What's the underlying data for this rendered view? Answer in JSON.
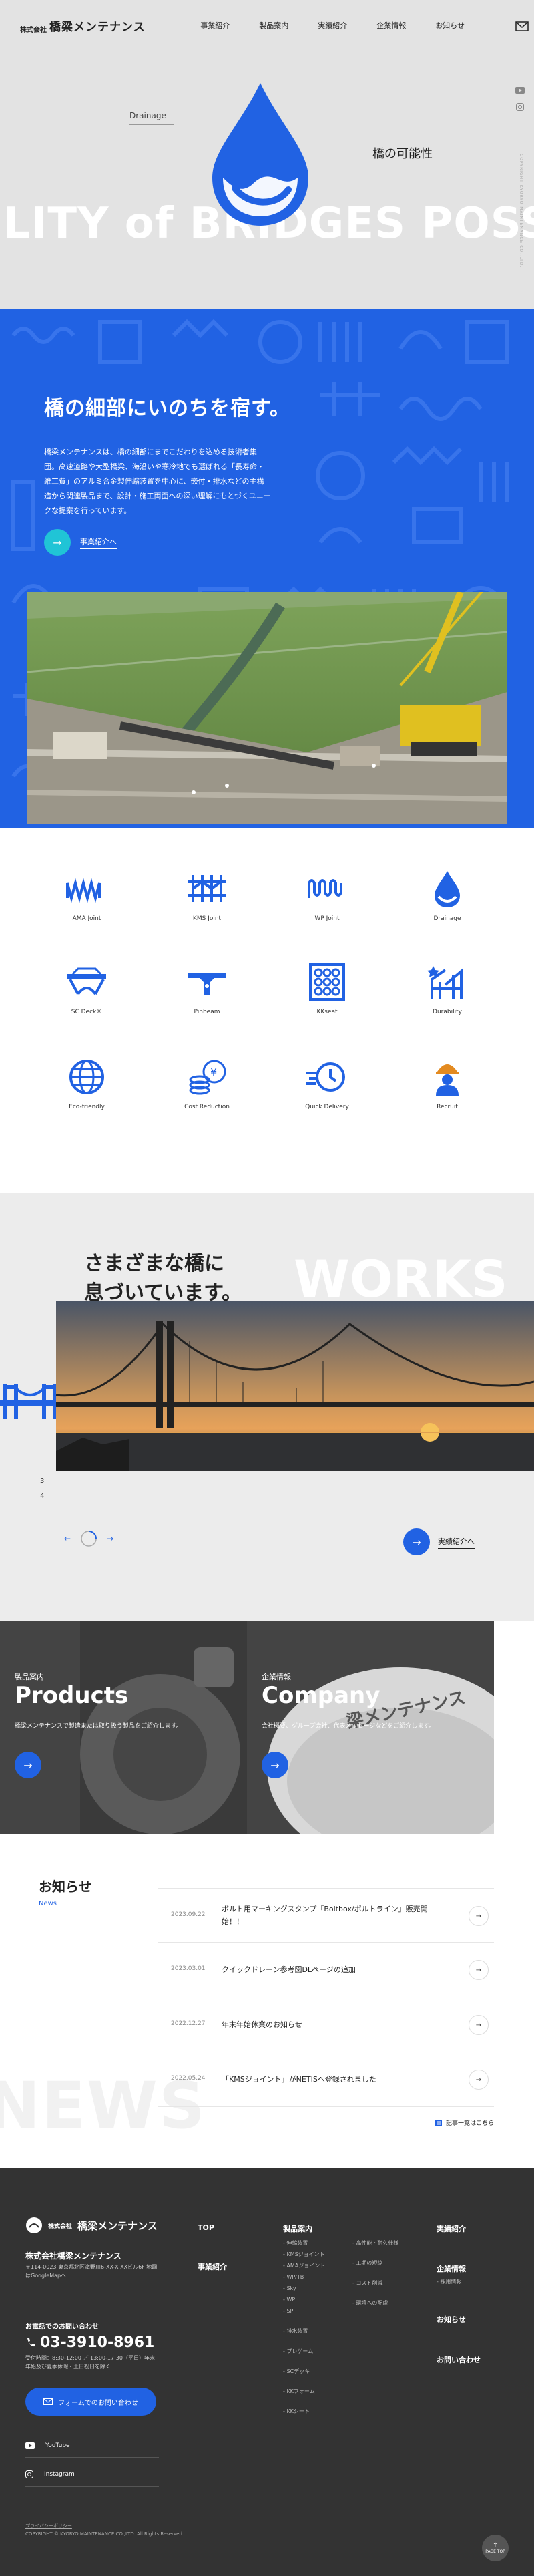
{
  "header": {
    "logo_small": "株式会社",
    "logo_large": "橋梁メンテナンス",
    "nav": [
      "事業紹介",
      "製品案内",
      "実績紹介",
      "企業情報",
      "お知らせ"
    ],
    "mail_icon": "mail-icon"
  },
  "hero": {
    "big_text": "ILITY of BRIDGES    POSSIBILITY",
    "drainage_label": "Drainage",
    "headline": "橋の可能性",
    "vertical_copy": "COPYRIGHT KYORYO MAINTENANCE CO.,LTD."
  },
  "intro": {
    "title": "橋の細部にいのちを宿す。",
    "description": "橋梁メンテナンスは、橋の細部にまでこだわりを込める技術者集団。高速道路や大型橋梁、海沿いや寒冷地でも選ばれる「長寿命・維工費」のアルミ合金製伸縮装置を中心に、嵌付・排水などの主構造から関連製品まで、設計・施工両面への深い理解にもとづくユニークな提案を行っています。",
    "more_label": "事業紹介へ"
  },
  "products": [
    {
      "label": "AMA Joint",
      "icon": "ama-joint-icon"
    },
    {
      "label": "KMS Joint",
      "icon": "kms-joint-icon"
    },
    {
      "label": "WP Joint",
      "icon": "wp-joint-icon"
    },
    {
      "label": "Drainage",
      "icon": "drainage-icon"
    },
    {
      "label": "SC Deck®",
      "icon": "sc-deck-icon"
    },
    {
      "label": "Pinbeam",
      "icon": "pinbeam-icon"
    },
    {
      "label": "KKseat",
      "icon": "kkseat-icon"
    },
    {
      "label": "Durability",
      "icon": "durability-icon"
    },
    {
      "label": "Eco-friendly",
      "icon": "eco-friendly-icon"
    },
    {
      "label": "Cost Reduction",
      "icon": "cost-reduction-icon"
    },
    {
      "label": "Quick Delivery",
      "icon": "quick-delivery-icon"
    },
    {
      "label": "Recruit",
      "icon": "recruit-icon"
    }
  ],
  "works": {
    "title_line1": "さまざまな橋に",
    "title_line2": "息づいています。",
    "big_text": "WORKS",
    "counter_current": "3",
    "counter_total": "4",
    "more_label": "実績紹介へ"
  },
  "cards": [
    {
      "jp": "製品案内",
      "en": "Products",
      "desc": "橋梁メンテナンスで製造または取り扱う製品をご紹介します。"
    },
    {
      "jp": "企業情報",
      "en": "Company",
      "desc": "会社概要、グループ会社、代表メッセージなどをご紹介します。"
    }
  ],
  "news": {
    "title": "お知らせ",
    "title_en": "News",
    "big_text": "NEWS",
    "items": [
      {
        "date": "2023.09.22",
        "text": "ボルト用マーキングスタンプ「Boltbox/ボルトライン」販売開始！！"
      },
      {
        "date": "2023.03.01",
        "text": "クイックドレーン参考図DLページの追加"
      },
      {
        "date": "2022.12.27",
        "text": "年末年始休業のお知らせ"
      },
      {
        "date": "2022.05.24",
        "text": "「KMSジョイント」がNETISへ登録されました"
      }
    ],
    "all_label": "記事一覧はこちら"
  },
  "footer": {
    "logo_small": "株式会社",
    "logo_large": "橋梁メンテナンス",
    "company": "株式会社橋梁メンテナンス",
    "address": "〒114-0023 東京都北区滝野川6-XX-X XXビル6F 地図はGoogleMapへ",
    "tel_label": "お電話でのお問い合わせ",
    "tel": "03-3910-8961",
    "hours": "受付時間：8:30-12:00 ／ 13:00-17:30（平日）年末年始及び夏季休暇・土日祝日を除く",
    "form_label": "フォームでのお問い合わせ",
    "youtube": "YouTube",
    "instagram": "Instagram",
    "col1": [
      "TOP",
      "事業紹介"
    ],
    "col2_head": "製品案内",
    "col2_a": [
      "伸縮装置",
      "KMSジョイント",
      "AMAジョイント",
      "WP/TB",
      "Sky",
      "WP",
      "SP"
    ],
    "col2_b": [
      "高性能・耐久仕様",
      "工期の短縮",
      "コスト削減",
      "環境への配慮"
    ],
    "col2_c": [
      "排水装置",
      "プレゲーム",
      "SCデッキ",
      "KKフォーム",
      "KKシート"
    ],
    "col3": [
      "実績紹介",
      "企業情報",
      "お知らせ",
      "お問い合わせ"
    ],
    "col3_sub": "採用情報",
    "privacy": "プライバシーポリシー",
    "copyright": "COPYRIGHT © KYORYO MAINTENANCE CO.,LTD. All Rights Reserved.",
    "pagetop": "PAGE TOP"
  },
  "colors": {
    "brand_blue": "#2162e3",
    "dark": "#333333",
    "light_gray": "#e3e3e3"
  }
}
